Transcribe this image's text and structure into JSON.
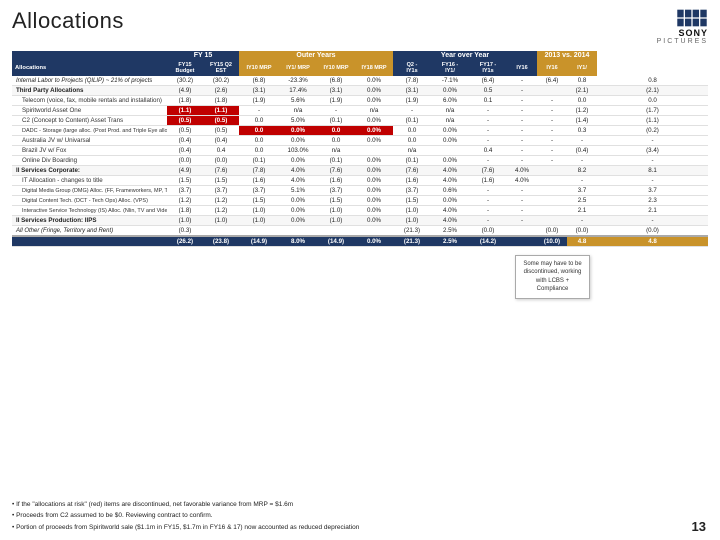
{
  "page": {
    "title": "Allocations",
    "page_number": "13"
  },
  "logo": {
    "line1": "SONY",
    "line2": "PICTURES"
  },
  "table": {
    "group_headers": [
      {
        "label": "FY 15",
        "colspan": 2,
        "style": "fy15"
      },
      {
        "label": "Outer Years",
        "colspan": 4,
        "style": "outer"
      },
      {
        "label": "Year over Year",
        "colspan": 4,
        "style": "yoy"
      },
      {
        "label": "2013 vs. 2014",
        "colspan": 2,
        "style": "vs2014"
      }
    ],
    "col_headers": [
      "Allocations",
      "FY15 Budget",
      "FY15 Q2 EST",
      "IY10 MRP",
      "IY1/ MRP",
      "IY10 MRP",
      "Q2 - IY1s",
      "FY16 - IY1/",
      "FY17 - IY1s",
      "IY16",
      "IY1/",
      "IY16",
      "IY1/"
    ],
    "rows": [
      {
        "label": "Internal Labor to Projects (QILIP) ~ 21% of projects",
        "type": "section",
        "values": [
          "(30.2)",
          "(30.2)",
          "(6.8)",
          "-23.3%",
          "(6.8)",
          "0.0%",
          "(7.8)",
          "-7.1%",
          "(6.4)",
          "-",
          "(6.4)",
          "0.8",
          "0.8"
        ]
      },
      {
        "label": "Third Party Allocations",
        "type": "section",
        "values": [
          "(4.9)",
          "(2.6)",
          "(3.1)",
          "17.4%",
          "(3.1)",
          "0.0%",
          "(3.1)",
          "0.0%",
          "0.5",
          "-",
          "(2.1)",
          "(2.1)",
          ""
        ]
      },
      {
        "label": "Telecom  (voice, fax, mobile rentals and installation)",
        "type": "sub",
        "values": [
          "(1.8)",
          "(1.8)",
          "(1.9)",
          "5.6%",
          "(1.9)",
          "0.0%",
          "(1.9)",
          "6.0%",
          "0.1",
          "-",
          "-",
          "0.0",
          "0.0"
        ]
      },
      {
        "label": "Spiritworld Asset One",
        "type": "sub",
        "values": [
          "(1.1)",
          "(1.1)",
          "-",
          "n/a",
          "-",
          "n/a",
          "-",
          "n/a",
          "-",
          "-",
          "-",
          "(1.2)",
          "(1.7)"
        ]
      },
      {
        "label": "C2 (Concept to Content) Asset Trans",
        "type": "sub",
        "values": [
          "(0.5)",
          "(0.5)",
          "0.0",
          "5.0%",
          "(0.1)",
          "0.0%",
          "(0.1)",
          "n/a",
          "-",
          "-",
          "-",
          "(1.4)",
          "(1.1)"
        ]
      },
      {
        "label": "DADC - Storage (large alloc. (Post Prod. and Triple Eye alloc. (DADC))",
        "type": "sub",
        "values": [
          "(0.5)",
          "(0.5)",
          "0.0",
          "0.0%",
          "0.0",
          "0.0%",
          "0.0",
          "0.0%",
          "-",
          "-",
          "-",
          "0.3",
          "(0.2)"
        ]
      },
      {
        "label": "Australia JV w/ Univarsal",
        "type": "sub",
        "values": [
          "(0.4)",
          "(0.4)",
          "0.0",
          "0.0%",
          "0.0",
          "0.0%",
          "0.0",
          "0.0%",
          "-",
          "-",
          "-",
          "-",
          "-"
        ]
      },
      {
        "label": "Brazil JV w/ Fox",
        "type": "sub",
        "values": [
          "(0.4)",
          "0.4",
          "0.0",
          "103.0%",
          "n/a",
          "",
          "n/a",
          "",
          "0.4",
          "-",
          "-",
          "(0.4)",
          "(3.4)"
        ]
      },
      {
        "label": "Online Div Boarding",
        "type": "sub",
        "values": [
          "(0.0)",
          "(0.0)",
          "(0.1)",
          "0.0%",
          "(0.1)",
          "0.0%",
          "(0.1)",
          "0.0%",
          "-",
          "-",
          "-",
          "-",
          "-"
        ]
      },
      {
        "label": "II Services Corporate:",
        "type": "section",
        "values": [
          "(4.9)",
          "(7.6)",
          "(7.8)",
          "4.0%",
          "(7.6)",
          "0.0%",
          "(7.6)",
          "4.0%",
          "(7.6)",
          "4.0%",
          "",
          "8.2",
          "8.1"
        ]
      },
      {
        "label": "IT Allocation - changes to title",
        "type": "sub",
        "values": [
          "(1.5)",
          "(1.5)",
          "(1.6)",
          "4.0%",
          "(1.6)",
          "0.0%",
          "(1.6)",
          "4.0%",
          "(1.6)",
          "4.0%",
          "",
          "-",
          "-"
        ]
      },
      {
        "label": "Digital Media Group (DMG) Alloc. (FF, Frameworkers, MP, TV and VPS)",
        "type": "sub",
        "values": [
          "(3.7)",
          "(3.7)",
          "(3.7)",
          "5.1%",
          "(3.7)",
          "0.0%",
          "(3.7)",
          "0.6%",
          "-",
          "-",
          "",
          "3.7",
          "3.7"
        ]
      },
      {
        "label": "Digital Content Tech. (DCT - Tech Ops) Alloc. (VPS)",
        "type": "sub",
        "values": [
          "(1.2)",
          "(1.2)",
          "(1.5)",
          "0.0%",
          "(1.5)",
          "0.0%",
          "(1.5)",
          "0.0%",
          "-",
          "-",
          "",
          "2.5",
          "2.3"
        ]
      },
      {
        "label": "Interactive Service Technology (IS) Alloc. (Nlin, TV and Video)",
        "type": "sub",
        "values": [
          "(1.8)",
          "(1.2)",
          "(1.0)",
          "0.0%",
          "(1.0)",
          "0.0%",
          "(1.0)",
          "4.0%",
          "-",
          "-",
          "",
          "2.1",
          "2.1"
        ]
      },
      {
        "label": "II Services Production: IIPS",
        "type": "section",
        "values": [
          "(1.0)",
          "(1.0)",
          "(1.0)",
          "0.0%",
          "(1.0)",
          "0.0%",
          "(1.0)",
          "4.0%",
          "-",
          "-",
          "",
          "-",
          "-"
        ]
      },
      {
        "label": "All Other (Fringe, Territory and Rent)",
        "type": "section",
        "values": [
          "(0.3)",
          "",
          "",
          "",
          "",
          "",
          "(21.3)",
          "2.5%",
          "(0.0)",
          "",
          "(0.0)",
          "(0.0)",
          "(0.0)"
        ]
      },
      {
        "label": "TOTAL",
        "type": "total",
        "values": [
          "(26.2)",
          "(23.8)",
          "(14.9)",
          "8.0%",
          "(14.9)",
          "0.0%",
          "(21.3)",
          "2.5%",
          "(14.2)",
          "",
          "(10.0)",
          "4.8",
          "4.8"
        ]
      }
    ]
  },
  "tooltip": {
    "text": "Some may have to be discontinued, working with LCBS + Compliance"
  },
  "bullets": [
    "• If the \"allocations at risk\" (red) items are discontinued, net favorable variance from MRP = $1.6m",
    "• Proceeds from C2 assumed to be $0.  Reviewing contract to confirm.",
    "• Portion of proceeds from Spiritworld sale ($1.1m in FY15, $1.7m in FY16 & 17) now accounted as reduced depreciation"
  ]
}
